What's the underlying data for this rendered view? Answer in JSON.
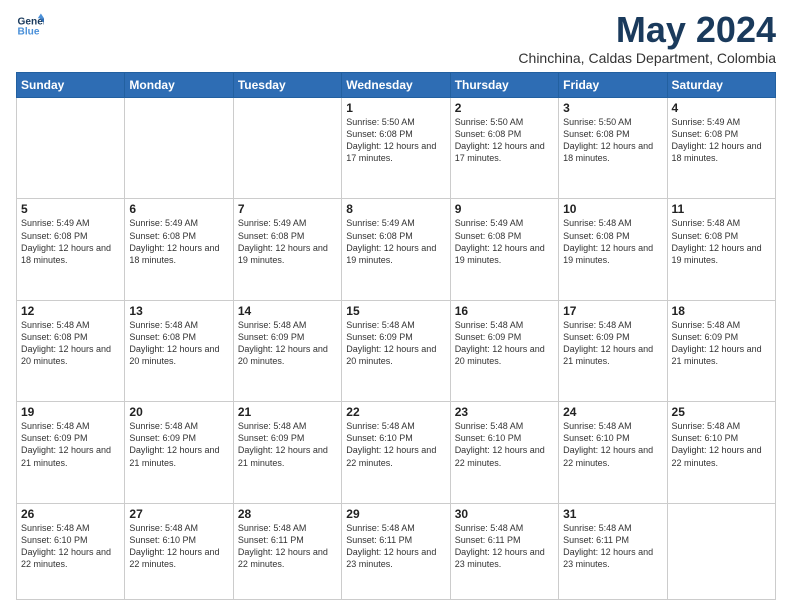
{
  "logo": {
    "line1": "General",
    "line2": "Blue"
  },
  "title": "May 2024",
  "subtitle": "Chinchina, Caldas Department, Colombia",
  "headers": [
    "Sunday",
    "Monday",
    "Tuesday",
    "Wednesday",
    "Thursday",
    "Friday",
    "Saturday"
  ],
  "weeks": [
    [
      {
        "day": "",
        "info": ""
      },
      {
        "day": "",
        "info": ""
      },
      {
        "day": "",
        "info": ""
      },
      {
        "day": "1",
        "info": "Sunrise: 5:50 AM\nSunset: 6:08 PM\nDaylight: 12 hours\nand 17 minutes."
      },
      {
        "day": "2",
        "info": "Sunrise: 5:50 AM\nSunset: 6:08 PM\nDaylight: 12 hours\nand 17 minutes."
      },
      {
        "day": "3",
        "info": "Sunrise: 5:50 AM\nSunset: 6:08 PM\nDaylight: 12 hours\nand 18 minutes."
      },
      {
        "day": "4",
        "info": "Sunrise: 5:49 AM\nSunset: 6:08 PM\nDaylight: 12 hours\nand 18 minutes."
      }
    ],
    [
      {
        "day": "5",
        "info": "Sunrise: 5:49 AM\nSunset: 6:08 PM\nDaylight: 12 hours\nand 18 minutes."
      },
      {
        "day": "6",
        "info": "Sunrise: 5:49 AM\nSunset: 6:08 PM\nDaylight: 12 hours\nand 18 minutes."
      },
      {
        "day": "7",
        "info": "Sunrise: 5:49 AM\nSunset: 6:08 PM\nDaylight: 12 hours\nand 19 minutes."
      },
      {
        "day": "8",
        "info": "Sunrise: 5:49 AM\nSunset: 6:08 PM\nDaylight: 12 hours\nand 19 minutes."
      },
      {
        "day": "9",
        "info": "Sunrise: 5:49 AM\nSunset: 6:08 PM\nDaylight: 12 hours\nand 19 minutes."
      },
      {
        "day": "10",
        "info": "Sunrise: 5:48 AM\nSunset: 6:08 PM\nDaylight: 12 hours\nand 19 minutes."
      },
      {
        "day": "11",
        "info": "Sunrise: 5:48 AM\nSunset: 6:08 PM\nDaylight: 12 hours\nand 19 minutes."
      }
    ],
    [
      {
        "day": "12",
        "info": "Sunrise: 5:48 AM\nSunset: 6:08 PM\nDaylight: 12 hours\nand 20 minutes."
      },
      {
        "day": "13",
        "info": "Sunrise: 5:48 AM\nSunset: 6:08 PM\nDaylight: 12 hours\nand 20 minutes."
      },
      {
        "day": "14",
        "info": "Sunrise: 5:48 AM\nSunset: 6:09 PM\nDaylight: 12 hours\nand 20 minutes."
      },
      {
        "day": "15",
        "info": "Sunrise: 5:48 AM\nSunset: 6:09 PM\nDaylight: 12 hours\nand 20 minutes."
      },
      {
        "day": "16",
        "info": "Sunrise: 5:48 AM\nSunset: 6:09 PM\nDaylight: 12 hours\nand 20 minutes."
      },
      {
        "day": "17",
        "info": "Sunrise: 5:48 AM\nSunset: 6:09 PM\nDaylight: 12 hours\nand 21 minutes."
      },
      {
        "day": "18",
        "info": "Sunrise: 5:48 AM\nSunset: 6:09 PM\nDaylight: 12 hours\nand 21 minutes."
      }
    ],
    [
      {
        "day": "19",
        "info": "Sunrise: 5:48 AM\nSunset: 6:09 PM\nDaylight: 12 hours\nand 21 minutes."
      },
      {
        "day": "20",
        "info": "Sunrise: 5:48 AM\nSunset: 6:09 PM\nDaylight: 12 hours\nand 21 minutes."
      },
      {
        "day": "21",
        "info": "Sunrise: 5:48 AM\nSunset: 6:09 PM\nDaylight: 12 hours\nand 21 minutes."
      },
      {
        "day": "22",
        "info": "Sunrise: 5:48 AM\nSunset: 6:10 PM\nDaylight: 12 hours\nand 22 minutes."
      },
      {
        "day": "23",
        "info": "Sunrise: 5:48 AM\nSunset: 6:10 PM\nDaylight: 12 hours\nand 22 minutes."
      },
      {
        "day": "24",
        "info": "Sunrise: 5:48 AM\nSunset: 6:10 PM\nDaylight: 12 hours\nand 22 minutes."
      },
      {
        "day": "25",
        "info": "Sunrise: 5:48 AM\nSunset: 6:10 PM\nDaylight: 12 hours\nand 22 minutes."
      }
    ],
    [
      {
        "day": "26",
        "info": "Sunrise: 5:48 AM\nSunset: 6:10 PM\nDaylight: 12 hours\nand 22 minutes."
      },
      {
        "day": "27",
        "info": "Sunrise: 5:48 AM\nSunset: 6:10 PM\nDaylight: 12 hours\nand 22 minutes."
      },
      {
        "day": "28",
        "info": "Sunrise: 5:48 AM\nSunset: 6:11 PM\nDaylight: 12 hours\nand 22 minutes."
      },
      {
        "day": "29",
        "info": "Sunrise: 5:48 AM\nSunset: 6:11 PM\nDaylight: 12 hours\nand 23 minutes."
      },
      {
        "day": "30",
        "info": "Sunrise: 5:48 AM\nSunset: 6:11 PM\nDaylight: 12 hours\nand 23 minutes."
      },
      {
        "day": "31",
        "info": "Sunrise: 5:48 AM\nSunset: 6:11 PM\nDaylight: 12 hours\nand 23 minutes."
      },
      {
        "day": "",
        "info": ""
      }
    ]
  ]
}
